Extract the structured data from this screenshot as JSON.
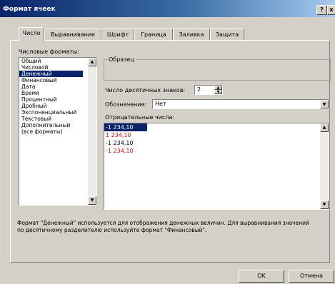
{
  "window": {
    "title": "Формат ячеек",
    "help_label": "?",
    "close_label": "x"
  },
  "tabs": [
    "Число",
    "Выравнивание",
    "Шрифт",
    "Граница",
    "Заливка",
    "Защита"
  ],
  "active_tab": "Число",
  "formats": {
    "label": "Числовые форматы:",
    "items": [
      "Общий",
      "Числовой",
      "Денежный",
      "Финансовый",
      "Дата",
      "Время",
      "Процентный",
      "Дробный",
      "Экспоненциальный",
      "Текстовый",
      "Дополнительный",
      "(все форматы)"
    ],
    "selected": "Денежный"
  },
  "sample": {
    "label": "Образец"
  },
  "decimals": {
    "label": "Число десятичных знаков:",
    "value": "2"
  },
  "symbol": {
    "label": "Обозначение:",
    "value": "Нет"
  },
  "negatives": {
    "label": "Отрицательные числа:",
    "items": [
      {
        "text": "-1 234,10",
        "color": "#000000"
      },
      {
        "text": "1 234,10",
        "color": "#d01010"
      },
      {
        "text": "-1 234,10",
        "color": "#000000"
      },
      {
        "text": "-1 234,10",
        "color": "#d01010"
      }
    ]
  },
  "description": "Формат \"Денежный\" используется для отображения денежных величин. Для выравнивания значений по десятичному разделителю используйте формат \"Финансовый\".",
  "buttons": {
    "ok": "OK",
    "cancel": "Отмена"
  }
}
